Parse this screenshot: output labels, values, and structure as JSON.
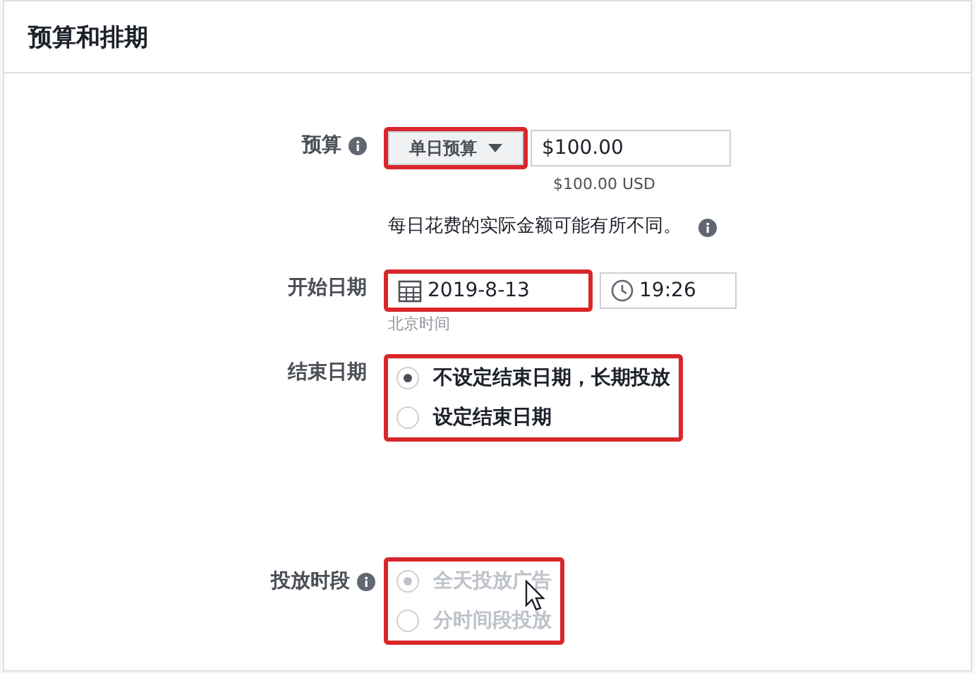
{
  "header": {
    "title": "预算和排期"
  },
  "budget": {
    "label": "预算",
    "type_button": "单日预算",
    "highlighted": true,
    "amount": "$100.00",
    "converted": "$100.00 USD",
    "note": "每日花费的实际金额可能有所不同。"
  },
  "start_date": {
    "label": "开始日期",
    "date": "2019-8-13",
    "highlighted": true,
    "time": "19:26",
    "timezone": "北京时间"
  },
  "end_date": {
    "label": "结束日期",
    "highlighted": true,
    "options": [
      {
        "label": "不设定结束日期，长期投放",
        "selected": true,
        "disabled": false
      },
      {
        "label": "设定结束日期",
        "selected": false,
        "disabled": false
      }
    ]
  },
  "schedule": {
    "label": "投放时段",
    "highlighted": true,
    "options": [
      {
        "label": "全天投放广告",
        "selected": true,
        "disabled": true
      },
      {
        "label": "分时间段投放",
        "selected": false,
        "disabled": true
      }
    ]
  }
}
